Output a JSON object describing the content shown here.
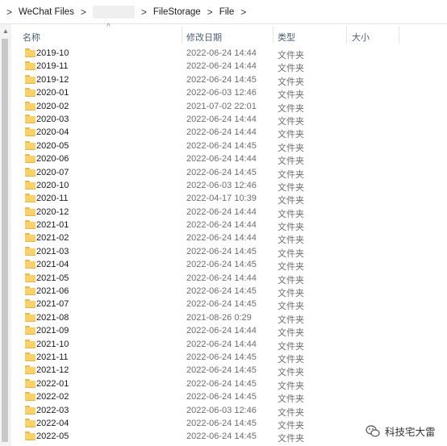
{
  "breadcrumb": {
    "items": [
      "WeChat Files",
      "FileStorage",
      "File"
    ],
    "separator": ">"
  },
  "columns": {
    "name": "名称",
    "date": "修改日期",
    "type": "类型",
    "size": "大小"
  },
  "rows": [
    {
      "name": "2019-10",
      "date": "2022-06-24 14:44",
      "type": "文件夹"
    },
    {
      "name": "2019-11",
      "date": "2022-06-24 14:44",
      "type": "文件夹"
    },
    {
      "name": "2019-12",
      "date": "2022-06-24 14:45",
      "type": "文件夹"
    },
    {
      "name": "2020-01",
      "date": "2022-06-03 12:46",
      "type": "文件夹"
    },
    {
      "name": "2020-02",
      "date": "2021-07-02 22:01",
      "type": "文件夹"
    },
    {
      "name": "2020-03",
      "date": "2022-06-24 14:44",
      "type": "文件夹"
    },
    {
      "name": "2020-04",
      "date": "2022-06-24 14:44",
      "type": "文件夹"
    },
    {
      "name": "2020-05",
      "date": "2022-06-24 14:45",
      "type": "文件夹"
    },
    {
      "name": "2020-06",
      "date": "2022-06-24 14:44",
      "type": "文件夹"
    },
    {
      "name": "2020-07",
      "date": "2022-06-24 14:45",
      "type": "文件夹"
    },
    {
      "name": "2020-10",
      "date": "2022-06-03 12:46",
      "type": "文件夹"
    },
    {
      "name": "2020-11",
      "date": "2022-04-17 10:39",
      "type": "文件夹"
    },
    {
      "name": "2020-12",
      "date": "2022-06-24 14:44",
      "type": "文件夹"
    },
    {
      "name": "2021-01",
      "date": "2022-06-24 14:44",
      "type": "文件夹"
    },
    {
      "name": "2021-02",
      "date": "2022-06-24 14:44",
      "type": "文件夹"
    },
    {
      "name": "2021-03",
      "date": "2022-06-24 14:45",
      "type": "文件夹"
    },
    {
      "name": "2021-04",
      "date": "2022-06-24 14:45",
      "type": "文件夹"
    },
    {
      "name": "2021-05",
      "date": "2022-06-24 14:44",
      "type": "文件夹"
    },
    {
      "name": "2021-06",
      "date": "2022-06-24 14:45",
      "type": "文件夹"
    },
    {
      "name": "2021-07",
      "date": "2022-06-24 14:45",
      "type": "文件夹"
    },
    {
      "name": "2021-08",
      "date": "2021-08-26 0:29",
      "type": "文件夹"
    },
    {
      "name": "2021-09",
      "date": "2022-06-24 14:44",
      "type": "文件夹"
    },
    {
      "name": "2021-10",
      "date": "2022-06-24 14:44",
      "type": "文件夹"
    },
    {
      "name": "2021-11",
      "date": "2022-06-24 14:45",
      "type": "文件夹"
    },
    {
      "name": "2021-12",
      "date": "2022-06-24 14:45",
      "type": "文件夹"
    },
    {
      "name": "2022-01",
      "date": "2022-06-24 14:45",
      "type": "文件夹"
    },
    {
      "name": "2022-02",
      "date": "2022-06-24 14:45",
      "type": "文件夹"
    },
    {
      "name": "2022-03",
      "date": "2022-06-03 12:46",
      "type": "文件夹"
    },
    {
      "name": "2022-04",
      "date": "2022-06-24 14:45",
      "type": "文件夹"
    },
    {
      "name": "2022-05",
      "date": "2022-06-24 14:45",
      "type": "文件夹"
    }
  ],
  "watermark": {
    "text": "科技宅大雷",
    "icon": "wechat-logo"
  }
}
